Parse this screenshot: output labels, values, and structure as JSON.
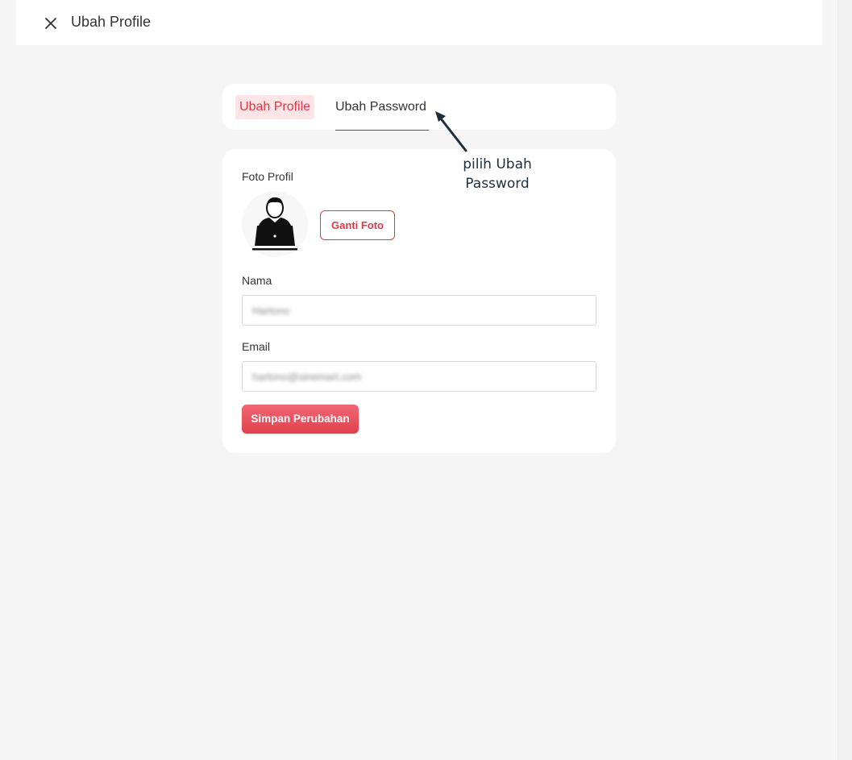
{
  "header": {
    "title": "Ubah Profile",
    "close_icon": "close-icon"
  },
  "tabs": [
    {
      "label": "Ubah Profile",
      "active": true
    },
    {
      "label": "Ubah Password",
      "active": false
    }
  ],
  "form": {
    "photo_label": "Foto Profil",
    "avatar_icon": "user-laptop-icon",
    "change_photo_label": "Ganti Foto",
    "name_label": "Nama",
    "name_value": "Hartono",
    "email_label": "Email",
    "email_value": "hartono@sinemart.com",
    "save_label": "Simpan Perubahan"
  },
  "annotation": {
    "text_line1": "pilih Ubah",
    "text_line2": "Password"
  },
  "colors": {
    "accent": "#e23744",
    "tab_active_bg": "#fde4e6",
    "background": "#f5f5f5",
    "annotation": "#1f2d3d"
  }
}
